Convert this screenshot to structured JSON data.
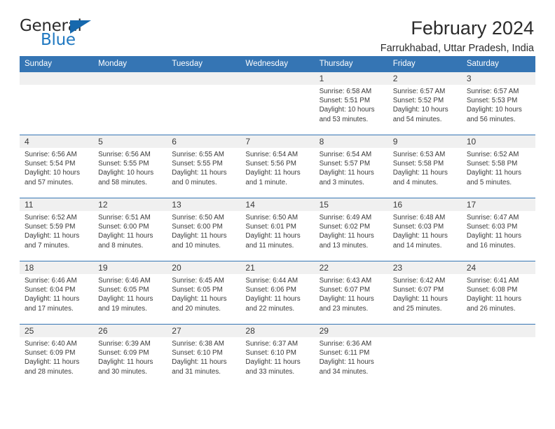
{
  "logo": {
    "word_one": "General",
    "word_two": "Blue",
    "triangle": "blue-triangle-icon"
  },
  "header": {
    "title": "February 2024",
    "subtitle": "Farrukhabad, Uttar Pradesh, India"
  },
  "colors": {
    "header_blue": "#3575b4",
    "daynum_band": "#f0f0f0",
    "text": "#3a3a3a",
    "logo_blue": "#1f78c1"
  },
  "weekday_headers": [
    "Sunday",
    "Monday",
    "Tuesday",
    "Wednesday",
    "Thursday",
    "Friday",
    "Saturday"
  ],
  "labels": {
    "sunrise_prefix": "Sunrise: ",
    "sunset_prefix": "Sunset: ",
    "daylight_prefix": "Daylight: "
  },
  "weeks": [
    [
      {
        "day": "",
        "sunrise": "",
        "sunset": "",
        "daylight": ""
      },
      {
        "day": "",
        "sunrise": "",
        "sunset": "",
        "daylight": ""
      },
      {
        "day": "",
        "sunrise": "",
        "sunset": "",
        "daylight": ""
      },
      {
        "day": "",
        "sunrise": "",
        "sunset": "",
        "daylight": ""
      },
      {
        "day": "1",
        "sunrise": "Sunrise: 6:58 AM",
        "sunset": "Sunset: 5:51 PM",
        "daylight": "Daylight: 10 hours and 53 minutes."
      },
      {
        "day": "2",
        "sunrise": "Sunrise: 6:57 AM",
        "sunset": "Sunset: 5:52 PM",
        "daylight": "Daylight: 10 hours and 54 minutes."
      },
      {
        "day": "3",
        "sunrise": "Sunrise: 6:57 AM",
        "sunset": "Sunset: 5:53 PM",
        "daylight": "Daylight: 10 hours and 56 minutes."
      }
    ],
    [
      {
        "day": "4",
        "sunrise": "Sunrise: 6:56 AM",
        "sunset": "Sunset: 5:54 PM",
        "daylight": "Daylight: 10 hours and 57 minutes."
      },
      {
        "day": "5",
        "sunrise": "Sunrise: 6:56 AM",
        "sunset": "Sunset: 5:55 PM",
        "daylight": "Daylight: 10 hours and 58 minutes."
      },
      {
        "day": "6",
        "sunrise": "Sunrise: 6:55 AM",
        "sunset": "Sunset: 5:55 PM",
        "daylight": "Daylight: 11 hours and 0 minutes."
      },
      {
        "day": "7",
        "sunrise": "Sunrise: 6:54 AM",
        "sunset": "Sunset: 5:56 PM",
        "daylight": "Daylight: 11 hours and 1 minute."
      },
      {
        "day": "8",
        "sunrise": "Sunrise: 6:54 AM",
        "sunset": "Sunset: 5:57 PM",
        "daylight": "Daylight: 11 hours and 3 minutes."
      },
      {
        "day": "9",
        "sunrise": "Sunrise: 6:53 AM",
        "sunset": "Sunset: 5:58 PM",
        "daylight": "Daylight: 11 hours and 4 minutes."
      },
      {
        "day": "10",
        "sunrise": "Sunrise: 6:52 AM",
        "sunset": "Sunset: 5:58 PM",
        "daylight": "Daylight: 11 hours and 5 minutes."
      }
    ],
    [
      {
        "day": "11",
        "sunrise": "Sunrise: 6:52 AM",
        "sunset": "Sunset: 5:59 PM",
        "daylight": "Daylight: 11 hours and 7 minutes."
      },
      {
        "day": "12",
        "sunrise": "Sunrise: 6:51 AM",
        "sunset": "Sunset: 6:00 PM",
        "daylight": "Daylight: 11 hours and 8 minutes."
      },
      {
        "day": "13",
        "sunrise": "Sunrise: 6:50 AM",
        "sunset": "Sunset: 6:00 PM",
        "daylight": "Daylight: 11 hours and 10 minutes."
      },
      {
        "day": "14",
        "sunrise": "Sunrise: 6:50 AM",
        "sunset": "Sunset: 6:01 PM",
        "daylight": "Daylight: 11 hours and 11 minutes."
      },
      {
        "day": "15",
        "sunrise": "Sunrise: 6:49 AM",
        "sunset": "Sunset: 6:02 PM",
        "daylight": "Daylight: 11 hours and 13 minutes."
      },
      {
        "day": "16",
        "sunrise": "Sunrise: 6:48 AM",
        "sunset": "Sunset: 6:03 PM",
        "daylight": "Daylight: 11 hours and 14 minutes."
      },
      {
        "day": "17",
        "sunrise": "Sunrise: 6:47 AM",
        "sunset": "Sunset: 6:03 PM",
        "daylight": "Daylight: 11 hours and 16 minutes."
      }
    ],
    [
      {
        "day": "18",
        "sunrise": "Sunrise: 6:46 AM",
        "sunset": "Sunset: 6:04 PM",
        "daylight": "Daylight: 11 hours and 17 minutes."
      },
      {
        "day": "19",
        "sunrise": "Sunrise: 6:46 AM",
        "sunset": "Sunset: 6:05 PM",
        "daylight": "Daylight: 11 hours and 19 minutes."
      },
      {
        "day": "20",
        "sunrise": "Sunrise: 6:45 AM",
        "sunset": "Sunset: 6:05 PM",
        "daylight": "Daylight: 11 hours and 20 minutes."
      },
      {
        "day": "21",
        "sunrise": "Sunrise: 6:44 AM",
        "sunset": "Sunset: 6:06 PM",
        "daylight": "Daylight: 11 hours and 22 minutes."
      },
      {
        "day": "22",
        "sunrise": "Sunrise: 6:43 AM",
        "sunset": "Sunset: 6:07 PM",
        "daylight": "Daylight: 11 hours and 23 minutes."
      },
      {
        "day": "23",
        "sunrise": "Sunrise: 6:42 AM",
        "sunset": "Sunset: 6:07 PM",
        "daylight": "Daylight: 11 hours and 25 minutes."
      },
      {
        "day": "24",
        "sunrise": "Sunrise: 6:41 AM",
        "sunset": "Sunset: 6:08 PM",
        "daylight": "Daylight: 11 hours and 26 minutes."
      }
    ],
    [
      {
        "day": "25",
        "sunrise": "Sunrise: 6:40 AM",
        "sunset": "Sunset: 6:09 PM",
        "daylight": "Daylight: 11 hours and 28 minutes."
      },
      {
        "day": "26",
        "sunrise": "Sunrise: 6:39 AM",
        "sunset": "Sunset: 6:09 PM",
        "daylight": "Daylight: 11 hours and 30 minutes."
      },
      {
        "day": "27",
        "sunrise": "Sunrise: 6:38 AM",
        "sunset": "Sunset: 6:10 PM",
        "daylight": "Daylight: 11 hours and 31 minutes."
      },
      {
        "day": "28",
        "sunrise": "Sunrise: 6:37 AM",
        "sunset": "Sunset: 6:10 PM",
        "daylight": "Daylight: 11 hours and 33 minutes."
      },
      {
        "day": "29",
        "sunrise": "Sunrise: 6:36 AM",
        "sunset": "Sunset: 6:11 PM",
        "daylight": "Daylight: 11 hours and 34 minutes."
      },
      {
        "day": "",
        "sunrise": "",
        "sunset": "",
        "daylight": ""
      },
      {
        "day": "",
        "sunrise": "",
        "sunset": "",
        "daylight": ""
      }
    ]
  ]
}
